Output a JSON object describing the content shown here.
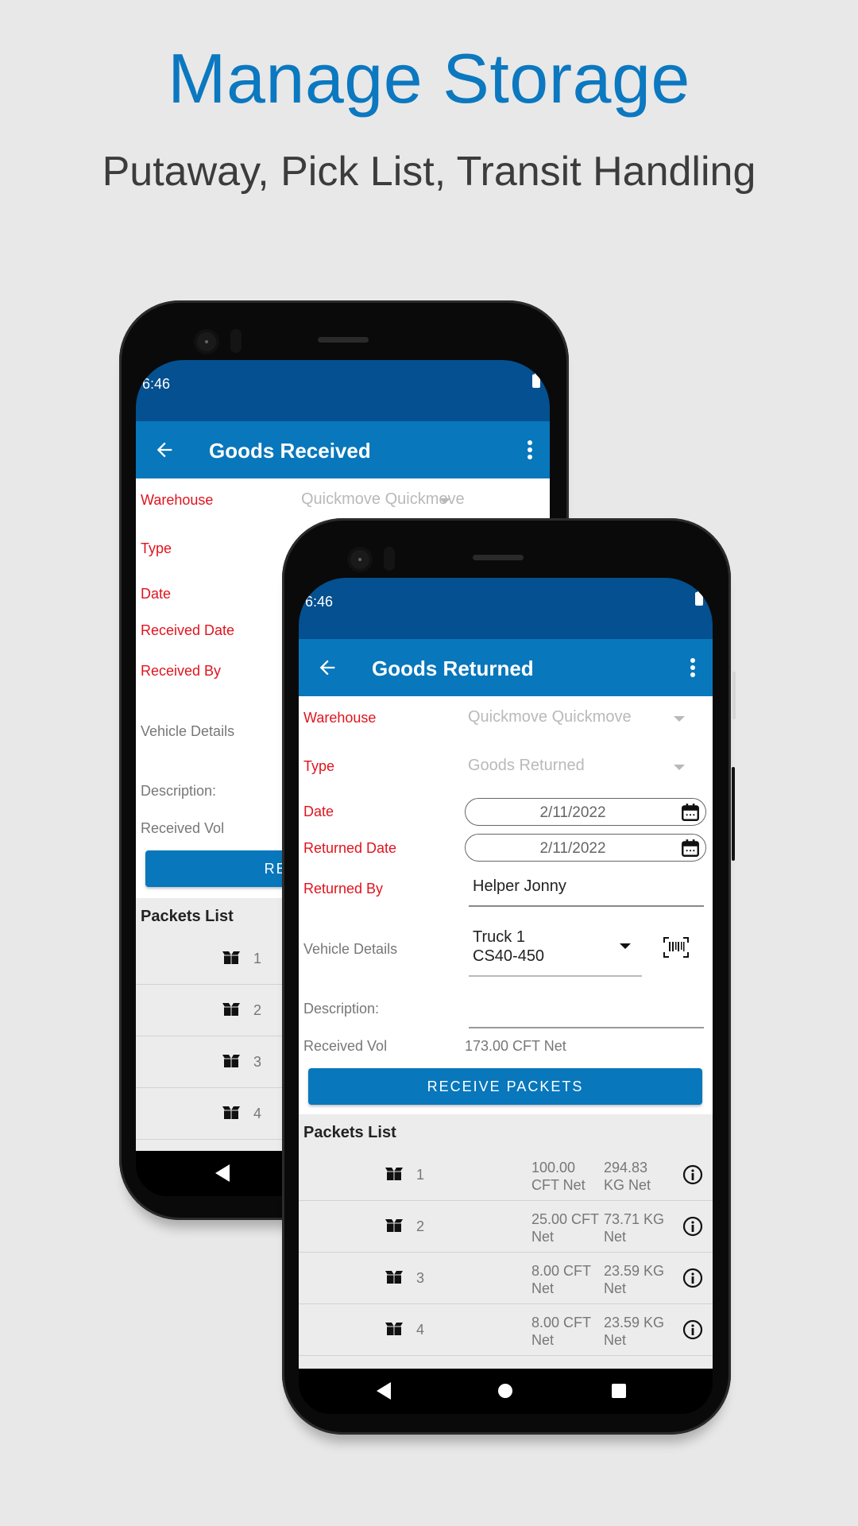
{
  "banner": {
    "title": "Manage Storage",
    "subtitle": "Putaway, Pick List, Transit Handling",
    "title_color": "#0b78c0"
  },
  "colors": {
    "status_bar": "#045090",
    "app_bar": "#0877bc",
    "required_label": "#e0141e"
  },
  "back_phone": {
    "status_time": "6:46",
    "app_title": "Goods Received",
    "labels": {
      "warehouse": "Warehouse",
      "type": "Type",
      "date": "Date",
      "received_date": "Received Date",
      "received_by": "Received By",
      "vehicle_details": "Vehicle Details",
      "description": "Description:",
      "received_vol": "Received Vol"
    },
    "warehouse_value": "Quickmove Quickmove",
    "button_label": "RECEIVE PACKETS",
    "packets_title": "Packets List",
    "packets": [
      {
        "no": "1"
      },
      {
        "no": "2"
      },
      {
        "no": "3"
      },
      {
        "no": "4"
      }
    ]
  },
  "front_phone": {
    "status_time": "6:46",
    "app_title": "Goods Returned",
    "labels": {
      "warehouse": "Warehouse",
      "type": "Type",
      "date": "Date",
      "returned_date": "Returned Date",
      "returned_by": "Returned By",
      "vehicle_details": "Vehicle Details",
      "description": "Description:",
      "received_vol": "Received Vol"
    },
    "warehouse_value": "Quickmove Quickmove",
    "type_value": "Goods Returned",
    "date_value": "2/11/2022",
    "returned_date_value": "2/11/2022",
    "returned_by_value": "Helper Jonny",
    "vehicle_line1": "Truck 1",
    "vehicle_line2": "CS40-450",
    "description_value": "",
    "received_vol_value": "173.00 CFT Net",
    "button_label": "RECEIVE PACKETS",
    "packets_title": "Packets List",
    "packets": [
      {
        "no": "1",
        "volume": "100.00 CFT Net",
        "weight": "294.83 KG Net"
      },
      {
        "no": "2",
        "volume": "25.00 CFT Net",
        "weight": "73.71 KG Net"
      },
      {
        "no": "3",
        "volume": "8.00 CFT Net",
        "weight": "23.59 KG Net"
      },
      {
        "no": "4",
        "volume": "8.00 CFT Net",
        "weight": "23.59 KG Net"
      }
    ]
  }
}
